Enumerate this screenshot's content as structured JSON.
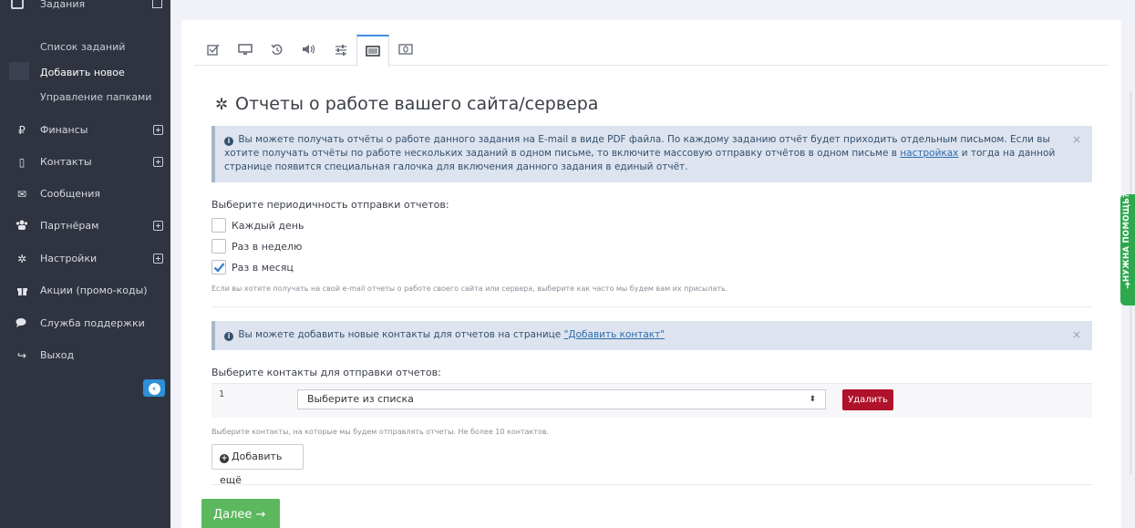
{
  "sidebar": {
    "top_item": "Задания",
    "subitems": [
      "Список заданий",
      "Добавить новое",
      "Управление папками"
    ],
    "nav": [
      {
        "label": "Финансы",
        "icon": "ruble-icon",
        "glyph": "₽",
        "expandable": true
      },
      {
        "label": "Контакты",
        "icon": "phone-icon",
        "glyph": "▯",
        "expandable": true
      },
      {
        "label": "Сообщения",
        "icon": "envelope-icon",
        "glyph": "✉",
        "expandable": false
      },
      {
        "label": "Партнёрам",
        "icon": "users-icon",
        "glyph": "👥",
        "expandable": true
      },
      {
        "label": "Настройки",
        "icon": "gear-icon",
        "glyph": "✲",
        "expandable": true
      },
      {
        "label": "Акции (промо-коды)",
        "icon": "gift-icon",
        "glyph": "🎁",
        "expandable": false
      },
      {
        "label": "Служба поддержки",
        "icon": "chat-icon",
        "glyph": "💬",
        "expandable": false
      },
      {
        "label": "Выход",
        "icon": "sign-out-icon",
        "glyph": "↪",
        "expandable": false
      }
    ]
  },
  "tabs": [
    {
      "icon": "checkbox-icon"
    },
    {
      "icon": "monitor-icon"
    },
    {
      "icon": "history-icon"
    },
    {
      "icon": "volume-icon"
    },
    {
      "icon": "sliders-icon"
    },
    {
      "icon": "list-alt-icon",
      "active": true
    },
    {
      "icon": "money-icon"
    }
  ],
  "main": {
    "title": "Отчеты о работе вашего сайта/сервера",
    "alert1": {
      "text_before": "Вы можете получать отчёты о работе данного задания на E-mail в виде PDF файла. По каждому заданию отчёт будет приходить отдельным письмом. Если вы хотите получать отчёты по работе нескольких заданий в одном письме, то включите массовую отправку отчётов в одном письме в ",
      "link": "настройках",
      "text_after": " и тогда на данной странице появится специальная галочка для включения данного задания в единый отчёт."
    },
    "frequency_label": "Выберите периодичность отправки отчетов:",
    "options": [
      {
        "label": "Каждый день",
        "checked": false
      },
      {
        "label": "Раз в неделю",
        "checked": false
      },
      {
        "label": "Раз в месяц",
        "checked": true
      }
    ],
    "frequency_hint": "Если вы хотите получать на свой e-mail отчеты о работе своего сайта или сервера, выберите как часто мы будем вам их присылать.",
    "alert2": {
      "text_before": "Вы можете добавить новые контакты для отчетов на странице ",
      "link": "\"Добавить контакт\""
    },
    "contacts_label": "Выберите контакты для отправки отчетов:",
    "contact_row": {
      "number": "1",
      "select_value": "Выберите из списка",
      "delete_label": "Удалить"
    },
    "contacts_hint": "Выберите контакты, на которые мы будем отправлять отчеты. Не более 10 контактов.",
    "add_more_label": "Добавить ещё",
    "next_label": "Далее →"
  },
  "help_tab": "НУЖНА ПОМОЩЬ?"
}
